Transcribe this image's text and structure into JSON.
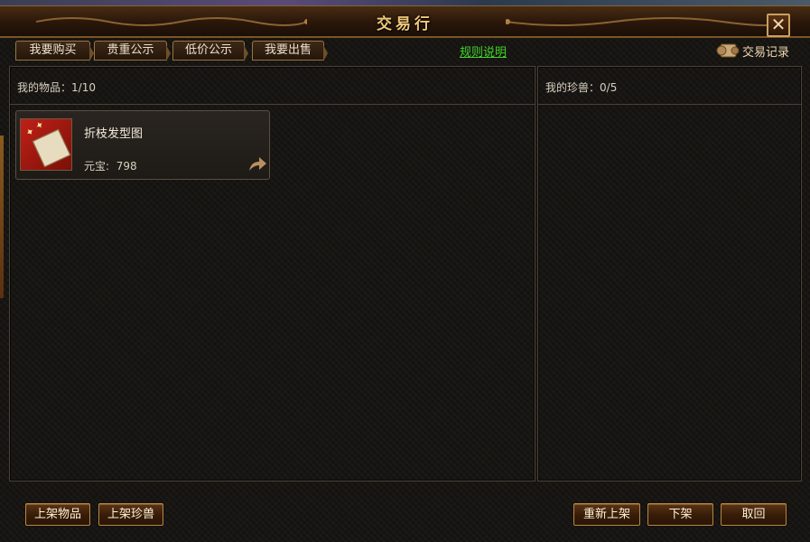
{
  "window": {
    "title": "交易行",
    "close_symbol": "✕"
  },
  "tabs": [
    {
      "label": "我要购买"
    },
    {
      "label": "贵重公示"
    },
    {
      "label": "低价公示"
    },
    {
      "label": "我要出售"
    }
  ],
  "rules_link": "规则说明",
  "records": {
    "label": "交易记录",
    "icon": "scroll-icon"
  },
  "left_panel": {
    "label": "我的物品：",
    "count": "1/10",
    "items": [
      {
        "name": "折枝发型图",
        "price_label": "元宝:",
        "price_value": "798",
        "icon": "hairstyle-scroll-icon",
        "action_icon": "share-arrow-icon"
      }
    ]
  },
  "right_panel": {
    "label": "我的珍兽：",
    "count": "0/5"
  },
  "bottom_buttons": {
    "list_item": "上架物品",
    "list_pet": "上架珍兽",
    "relist": "重新上架",
    "delist": "下架",
    "retrieve": "取回"
  },
  "colors": {
    "title": "#f0c878",
    "rules_link": "#3fd42a",
    "button_border": "#b08a4c",
    "panel_bg": "#171512"
  }
}
